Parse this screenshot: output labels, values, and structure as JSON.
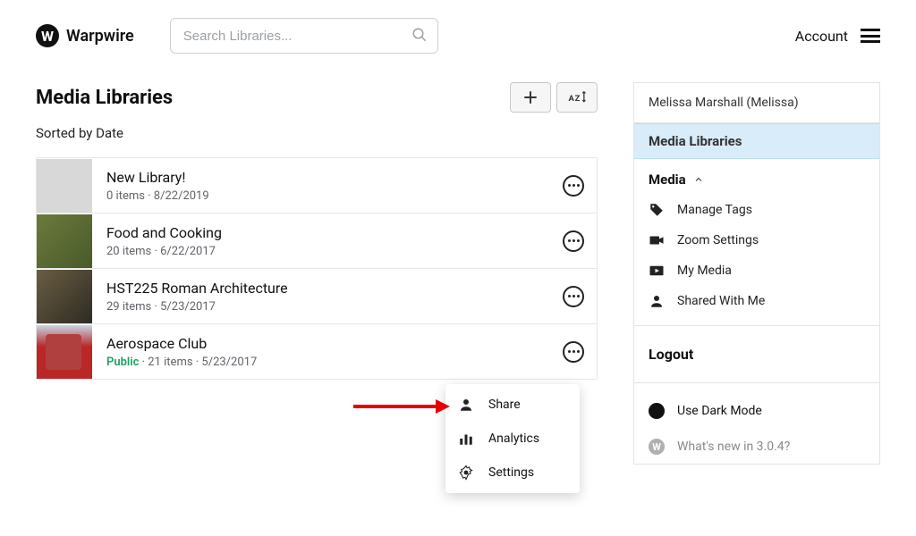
{
  "brand": {
    "name": "Warpwire",
    "logo_letter": "W"
  },
  "search": {
    "placeholder": "Search Libraries..."
  },
  "header": {
    "account_label": "Account"
  },
  "page": {
    "title": "Media Libraries",
    "sort_line": "Sorted by Date"
  },
  "libraries": [
    {
      "title": "New Library!",
      "meta": "0 items · 8/22/2019",
      "thumb": "blank"
    },
    {
      "title": "Food and Cooking",
      "meta": "20 items · 6/22/2017",
      "thumb": "food"
    },
    {
      "title": "HST225 Roman Architecture",
      "meta": "29 items · 5/23/2017",
      "thumb": "arch"
    },
    {
      "title": "Aerospace Club",
      "public_label": "Public",
      "meta_after_public": " · 21 items · 5/23/2017",
      "thumb": "aero"
    }
  ],
  "sidebar": {
    "user": "Melissa Marshall (Melissa)",
    "active_item": "Media Libraries",
    "section_header": "Media",
    "items": [
      {
        "label": "Manage Tags",
        "icon": "tag"
      },
      {
        "label": "Zoom Settings",
        "icon": "camera"
      },
      {
        "label": "My Media",
        "icon": "play"
      },
      {
        "label": "Shared With Me",
        "icon": "person"
      }
    ],
    "logout_label": "Logout",
    "dark_mode_label": "Use Dark Mode",
    "whats_new_label": "What's new in 3.0.4?"
  },
  "popup": {
    "items": [
      {
        "label": "Share",
        "icon": "person"
      },
      {
        "label": "Analytics",
        "icon": "bars"
      },
      {
        "label": "Settings",
        "icon": "gear"
      }
    ]
  }
}
